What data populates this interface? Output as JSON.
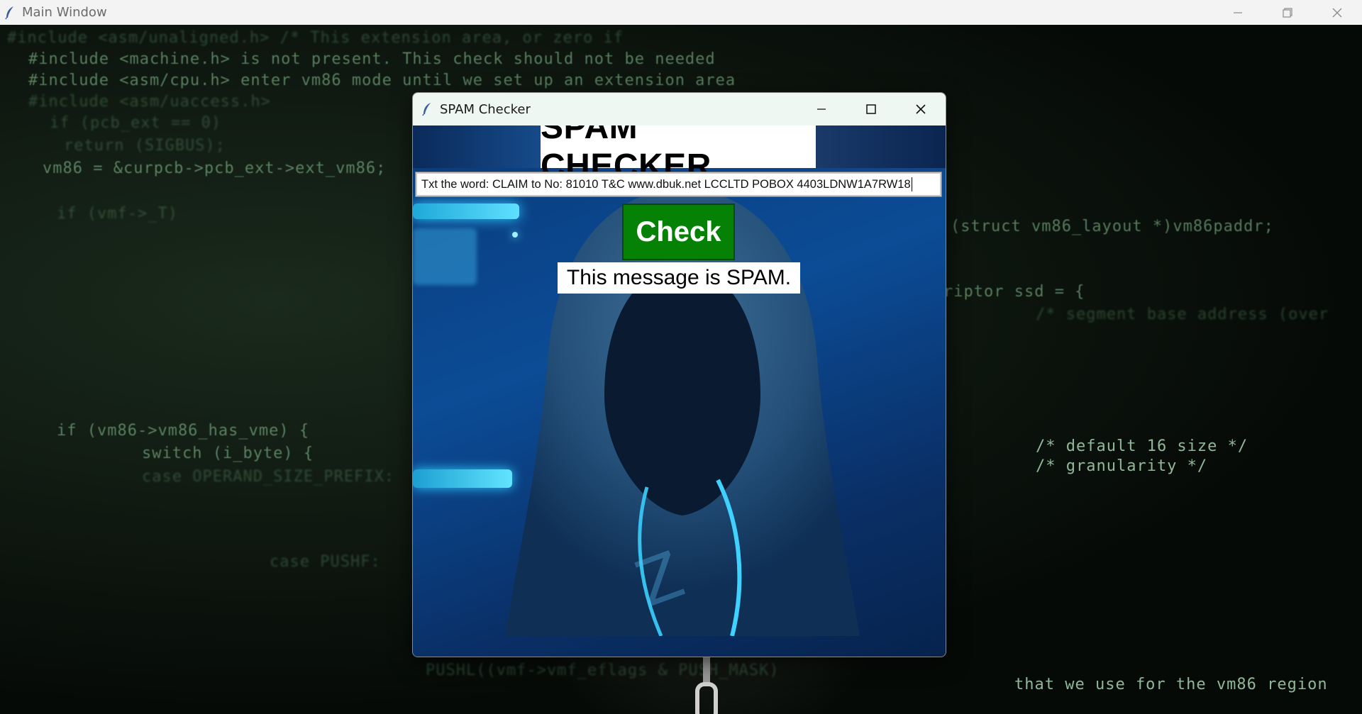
{
  "main_window": {
    "title": "Main Window",
    "controls": {
      "minimize": "minimize-icon",
      "restore": "restore-icon",
      "close": "close-icon"
    }
  },
  "background_code": [
    "#include <asm/unaligned.h>  /* This extension area, or zero if",
    "#include <machine.h> is not present. This check should not be needed",
    "#include <asm/cpu.h> enter vm86 mode until we set up an extension area",
    "#include <asm/uaccess.h>",
    "    if (pcb_ext == 0)",
    "        return (SIGBUS);",
    "    vm86 = &curpcb->pcb_ext->ext_vm86;",
    "    if (vmf->_T)",
    "    case OPERAND_SIZE_PREFIX:",
    "    if (vm86->vm86_has_vme) {",
    "        switch (i_byte) {",
    "    case PUSHF:",
    "    PUSHL((vmf->vmf_eflags & PUSH_MASK)",
    "    (struct vm86_layout *)vm86paddr;",
    "    riptor ssd = {",
    "    /* segment base address (over",
    "    /* default 16 size */",
    "    /* granularity */",
    "    that we use for the vm86 region"
  ],
  "spam_window": {
    "title": "SPAM Checker",
    "controls": {
      "minimize": "minimize-icon",
      "maximize": "maximize-icon",
      "close": "close-icon"
    },
    "header": "SPAM CHECKER",
    "message_input": {
      "value": "Txt the word: CLAIM to No: 81010 T&C www.dbuk.net LCCLTD POBOX 4403LDNW1A7RW18"
    },
    "check_button_label": "Check",
    "result_text": "This message is SPAM."
  },
  "colors": {
    "check_button": "#058205",
    "titlebar_main": "#f3f3f3",
    "titlebar_spam": "#eef7f1",
    "background_code": "#8fdc9a",
    "canvas_blue": "#0b4c96"
  }
}
